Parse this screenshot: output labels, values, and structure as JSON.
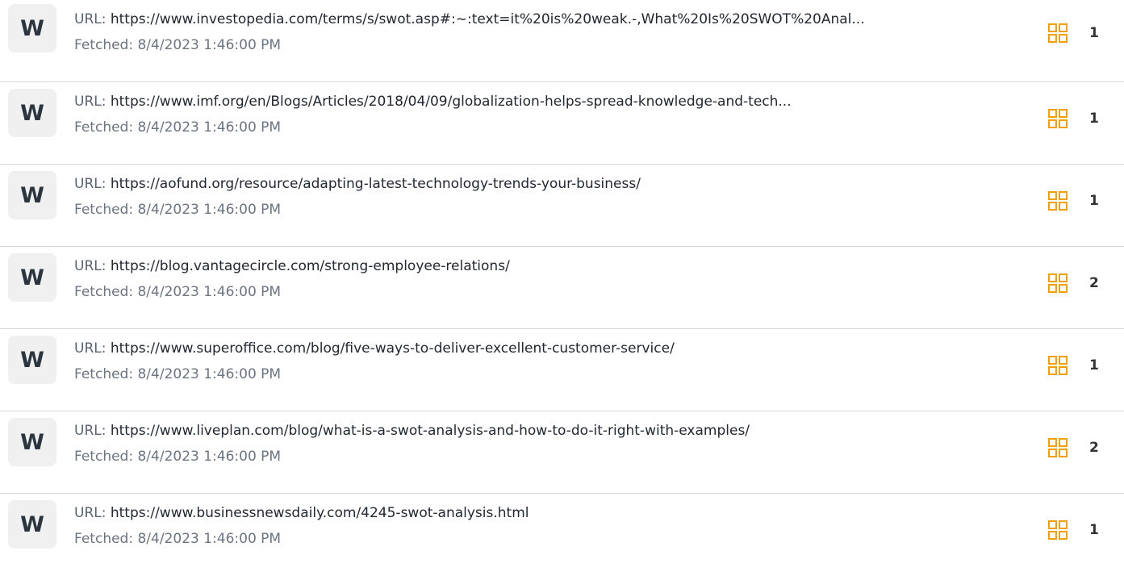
{
  "url_prefix": "URL: ",
  "accent_color": "#f0a000",
  "sources": [
    {
      "badge": "W",
      "url": "https://www.investopedia.com/terms/s/swot.asp#:~:text=it%20is%20weak.-,What%20Is%20SWOT%20Anal...",
      "fetched": "Fetched: 8/4/2023 1:46:00 PM",
      "count": "1",
      "icon": "grid-icon"
    },
    {
      "badge": "W",
      "url": "https://www.imf.org/en/Blogs/Articles/2018/04/09/globalization-helps-spread-knowledge-and-tech...",
      "fetched": "Fetched: 8/4/2023 1:46:00 PM",
      "count": "1",
      "icon": "grid-icon"
    },
    {
      "badge": "W",
      "url": "https://aofund.org/resource/adapting-latest-technology-trends-your-business/",
      "fetched": "Fetched: 8/4/2023 1:46:00 PM",
      "count": "1",
      "icon": "grid-icon"
    },
    {
      "badge": "W",
      "url": "https://blog.vantagecircle.com/strong-employee-relations/",
      "fetched": "Fetched: 8/4/2023 1:46:00 PM",
      "count": "2",
      "icon": "grid-icon"
    },
    {
      "badge": "W",
      "url": "https://www.superoffice.com/blog/five-ways-to-deliver-excellent-customer-service/",
      "fetched": "Fetched: 8/4/2023 1:46:00 PM",
      "count": "1",
      "icon": "grid-icon"
    },
    {
      "badge": "W",
      "url": "https://www.liveplan.com/blog/what-is-a-swot-analysis-and-how-to-do-it-right-with-examples/",
      "fetched": "Fetched: 8/4/2023 1:46:00 PM",
      "count": "2",
      "icon": "grid-icon"
    },
    {
      "badge": "W",
      "url": "https://www.businessnewsdaily.com/4245-swot-analysis.html",
      "fetched": "Fetched: 8/4/2023 1:46:00 PM",
      "count": "1",
      "icon": "grid-icon"
    }
  ]
}
